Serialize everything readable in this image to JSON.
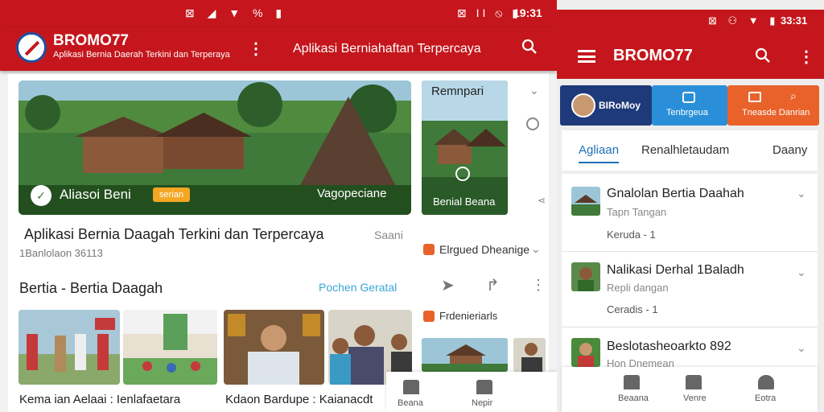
{
  "left": {
    "status": {
      "icons": "⊠ ◢ ▼ % ▮",
      "icons_right": "⊠ ΙΙ ⦸ ▮",
      "time": "19:31"
    },
    "appbar": {
      "brand": "BROMO77",
      "tagline": "Aplikasi Bernia Daerah Terkini dan Terperaya",
      "title": "Aplikasi Berniahaftan Terpercaya"
    },
    "hero": {
      "caption": "Aliasoi Beni",
      "badge": "serian",
      "right_label": "Vagopeciane"
    },
    "headline": {
      "text": "Aplikasi Bernia Daagah Terkini dan Terpercaya",
      "source": "Saani",
      "meta": "1Banlolaon 36113"
    },
    "section": {
      "title": "Bertia - Bertia Daagah",
      "link": "Pochen Geratal"
    },
    "thumbs": [
      {
        "caption": "Kema ian Aelaai : Ienlafaetara"
      },
      {
        "caption": ""
      },
      {
        "caption": "Kdaon Bardupe : Kaianacdt"
      },
      {
        "caption": ""
      }
    ],
    "side": {
      "card_title": "Remnpari",
      "card_caption": "Benial Beana",
      "row1": "Elrgued Dheanige",
      "row2": "Frdenieriarls"
    },
    "bottomnav": [
      {
        "label": "Beana"
      },
      {
        "label": "Nepir"
      }
    ]
  },
  "right": {
    "status": {
      "icons": "⊠ ⚇ ▼ ▮",
      "time": "33:31"
    },
    "appbar": {
      "brand": "BROMO77"
    },
    "tiles": [
      {
        "label": "BIRoMoy",
        "color": "#1f3a7a"
      },
      {
        "label": "Tenbrgeua",
        "color": "#2a8fd8"
      },
      {
        "label": "Tneasde Danrian",
        "color": "#e8622a"
      }
    ],
    "tabs": [
      {
        "label": "Agliaan"
      },
      {
        "label": "Renalhletaudam"
      },
      {
        "label": "Daany"
      }
    ],
    "list": [
      {
        "title": "Gnalolan Bertia Daahah",
        "sub": "Tapn Tangan",
        "meta": "Keruda - 1"
      },
      {
        "title": "Nalikasi Derhal 1Baladh",
        "sub": "Repli dangan",
        "meta": "Ceradis - 1"
      },
      {
        "title": "Beslotasheoarkto 892",
        "sub": "Hon Dnemean",
        "meta": ""
      }
    ],
    "bottomnav": [
      {
        "label": "Beaana"
      },
      {
        "label": "Venre"
      },
      {
        "label": "Eotra"
      }
    ]
  },
  "colors": {
    "brand_red": "#c4161c",
    "link_blue": "#3aa6d8",
    "accent_orange": "#e8622a"
  }
}
